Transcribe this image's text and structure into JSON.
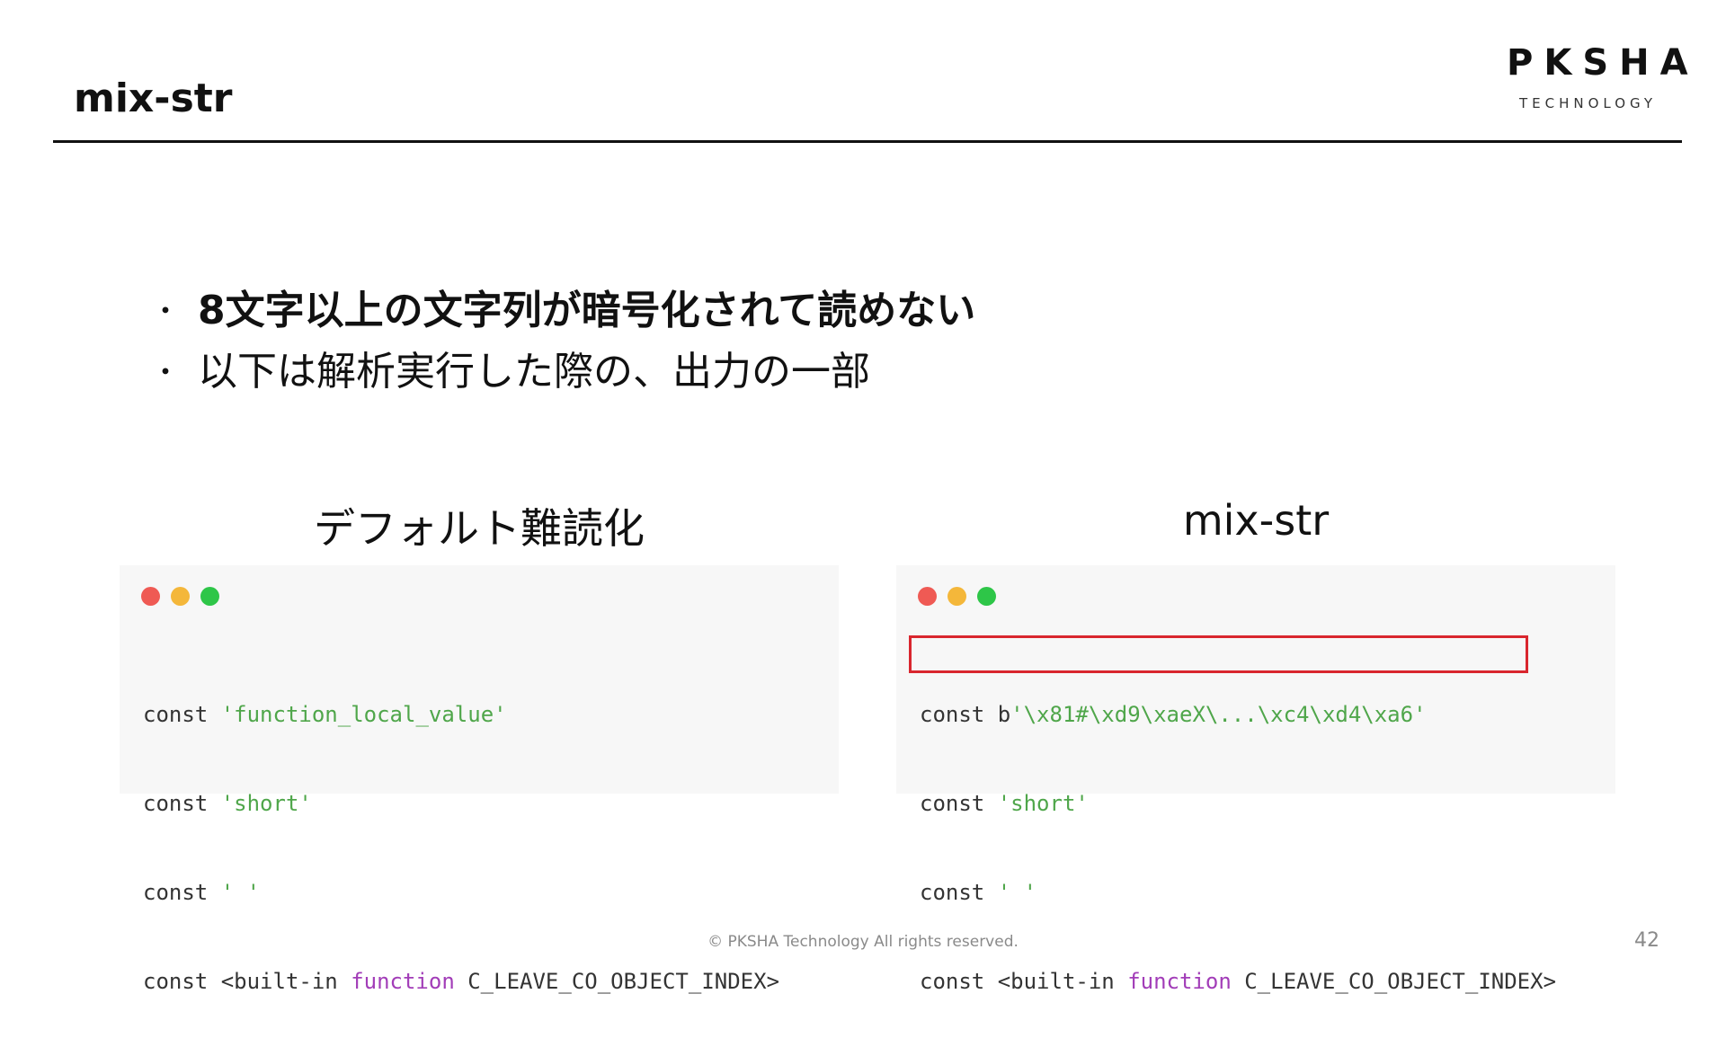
{
  "slide": {
    "title": "mix-str",
    "logo": {
      "main": "PKSHA",
      "sub": "TECHNOLOGY"
    },
    "bullets": [
      {
        "marker": "・",
        "text": "8文字以上の文字列が暗号化されて読めない"
      },
      {
        "marker": "・",
        "text": "以下は解析実行した際の、出力の一部"
      }
    ],
    "panels": {
      "left": {
        "heading": "デフォルト難読化",
        "lines": [
          {
            "prefix": "const ",
            "str": "'function_local_value'"
          },
          {
            "prefix": "const ",
            "str": "'short'"
          },
          {
            "prefix": "const ",
            "str": "' '"
          },
          {
            "prefix": "const <built-in ",
            "kw": "function",
            "suffix": " C_LEAVE_CO_OBJECT_INDEX>"
          }
        ]
      },
      "right": {
        "heading": "mix-str",
        "lines": [
          {
            "prefix": "const b",
            "str": "'\\x81#\\xd9\\xaeX\\...\\xc4\\xd4\\xa6'"
          },
          {
            "prefix": "const ",
            "str": "'short'"
          },
          {
            "prefix": "const ",
            "str": "' '"
          },
          {
            "prefix": "const <built-in ",
            "kw": "function",
            "suffix": " C_LEAVE_CO_OBJECT_INDEX>"
          }
        ]
      }
    },
    "footer": {
      "copyright": "© PKSHA Technology All rights reserved.",
      "page_number": "42"
    },
    "colors": {
      "string": "#4fa64a",
      "keyword": "#a23db8",
      "highlight": "#d9262e",
      "dot_red": "#ef5a54",
      "dot_yellow": "#f4b73a",
      "dot_green": "#2ec648"
    }
  }
}
